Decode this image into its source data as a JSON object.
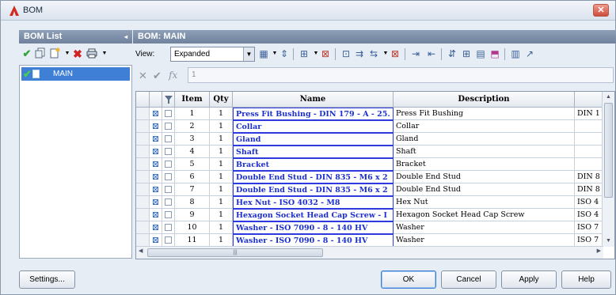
{
  "window": {
    "title": "BOM",
    "close_glyph": "✕"
  },
  "left_panel": {
    "header": "BOM List",
    "collapse_glyph": "◂",
    "toolbar_icons": [
      "check-icon",
      "copy-icon",
      "new-bom-icon",
      "dropdown-icon",
      "delete-icon",
      "print-icon",
      "dropdown-icon"
    ],
    "tree_items": [
      {
        "label": "MAIN"
      }
    ]
  },
  "right_panel": {
    "header": "BOM: MAIN",
    "view_label": "View:",
    "view_value": "Expanded",
    "toolbar_icons": [
      "grid-icon",
      "sort-icon",
      "insert-column-icon",
      "delete-column-icon",
      "merge-icon",
      "filter-icon",
      "table-icon",
      "formula-icon"
    ]
  },
  "formula": {
    "value": "1"
  },
  "grid": {
    "columns": [
      "",
      "",
      "",
      "Item",
      "Qty",
      "Name",
      "Description",
      ""
    ],
    "rows": [
      {
        "item": "1",
        "qty": "1",
        "name": "Press Fit Bushing - DIN 179 - A - 25.",
        "desc": "Press Fit Bushing",
        "last": "DIN 1"
      },
      {
        "item": "2",
        "qty": "1",
        "name": "Collar",
        "desc": "Collar",
        "last": ""
      },
      {
        "item": "3",
        "qty": "1",
        "name": "Gland",
        "desc": "Gland",
        "last": ""
      },
      {
        "item": "4",
        "qty": "1",
        "name": "Shaft",
        "desc": "Shaft",
        "last": ""
      },
      {
        "item": "5",
        "qty": "1",
        "name": "Bracket",
        "desc": "Bracket",
        "last": ""
      },
      {
        "item": "6",
        "qty": "1",
        "name": "Double End Stud - DIN 835 - M6 x 2",
        "desc": "Double End Stud",
        "last": "DIN 8"
      },
      {
        "item": "7",
        "qty": "1",
        "name": "Double End Stud - DIN 835 - M6 x 2",
        "desc": "Double End Stud",
        "last": "DIN 8"
      },
      {
        "item": "8",
        "qty": "1",
        "name": "Hex Nut - ISO 4032 - M8",
        "desc": "Hex Nut",
        "last": "ISO 4"
      },
      {
        "item": "9",
        "qty": "1",
        "name": "Hexagon Socket Head Cap Screw - I",
        "desc": "Hexagon Socket Head Cap Screw",
        "last": "ISO 4"
      },
      {
        "item": "10",
        "qty": "1",
        "name": "Washer - ISO 7090 - 8 - 140 HV",
        "desc": "Washer",
        "last": "ISO 7"
      },
      {
        "item": "11",
        "qty": "1",
        "name": "Washer - ISO 7090 - 8 - 140 HV",
        "desc": "Washer",
        "last": "ISO 7"
      }
    ]
  },
  "buttons": {
    "settings": "Settings...",
    "ok": "OK",
    "cancel": "Cancel",
    "apply": "Apply",
    "help": "Help"
  },
  "colors": {
    "accent": "#3f7fd5",
    "name_text": "#1b2ecf",
    "header_bg": "#7f91ab"
  }
}
